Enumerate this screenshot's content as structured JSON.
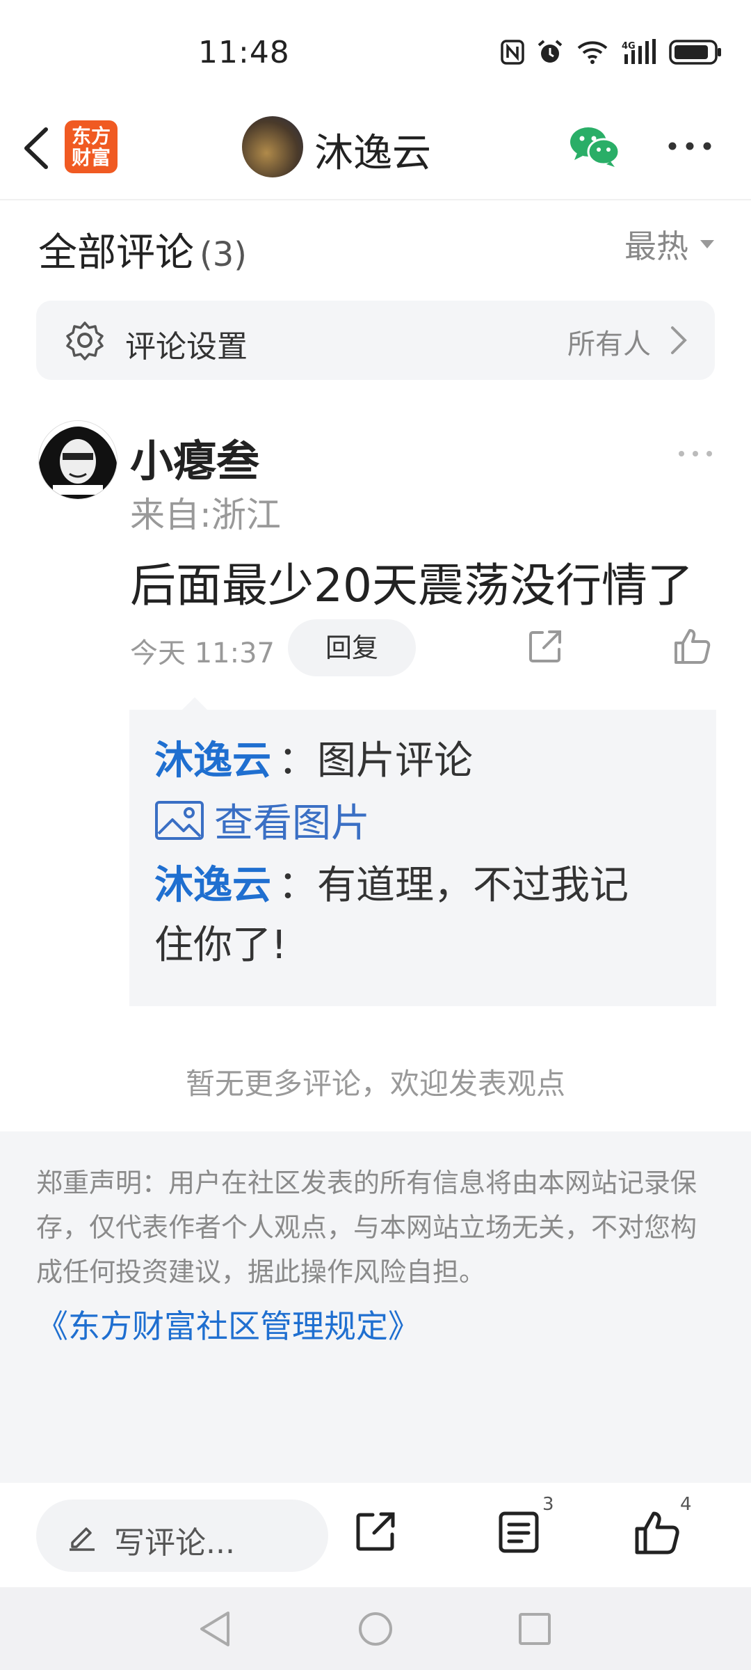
{
  "status": {
    "time": "11:48"
  },
  "nav": {
    "logo_text": "东方财富",
    "title": "沐逸云"
  },
  "comments_header": {
    "title": "全部评论",
    "count": "(3)",
    "sort_label": "最热"
  },
  "settings_row": {
    "label": "评论设置",
    "value": "所有人"
  },
  "comment": {
    "username": "小瘪叁",
    "location": "来自:浙江",
    "text": "后面最少20天震荡没行情了",
    "time": "今天 11:37",
    "reply_label": "回复"
  },
  "replies": [
    {
      "user": "沐逸云",
      "text": "：图片评论"
    },
    {
      "view_image": "查看图片"
    },
    {
      "user": "沐逸云",
      "text_line1": "：有道理，不过我记",
      "text_line2": "住你了!"
    }
  ],
  "no_more_text": "暂无更多评论，欢迎发表观点",
  "disclaimer": {
    "text": "郑重声明：用户在社区发表的所有信息将由本网站记录保存，仅代表作者个人观点，与本网站立场无关，不对您构成任何投资建议，据此操作风险自担。",
    "link": "《东方财富社区管理规定》"
  },
  "bottom_bar": {
    "write_placeholder": "写评论...",
    "comment_count": "3",
    "like_count": "4"
  },
  "icons": [
    "back-icon",
    "wechat-icon",
    "more-icon",
    "gear-icon",
    "chevron-right-icon",
    "share-icon",
    "like-icon",
    "image-icon",
    "pencil-icon",
    "comments-icon"
  ],
  "colors": {
    "accent_blue": "#1f6fd0",
    "logo_orange": "#f05a22",
    "wechat_green": "#2aae67"
  }
}
